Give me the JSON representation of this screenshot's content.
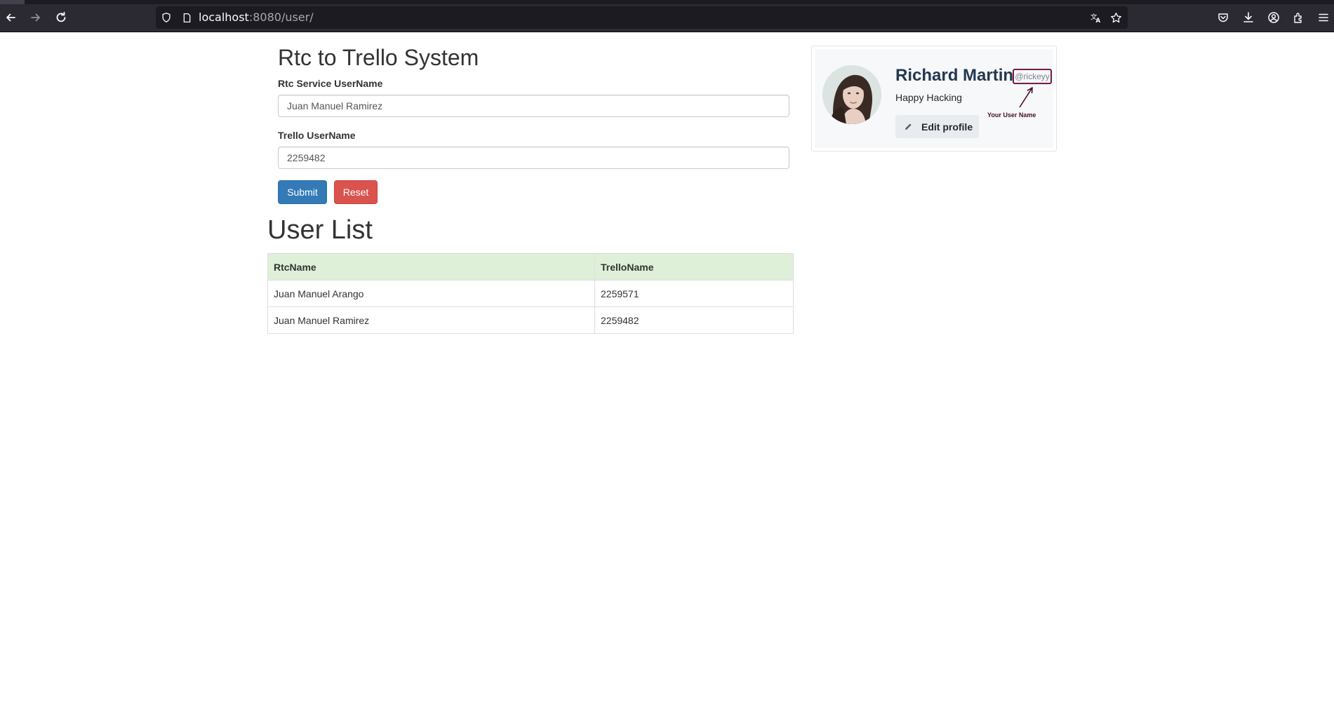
{
  "browser": {
    "url_host": "localhost",
    "url_rest": ":8080/user/",
    "icons": {
      "back": "back-arrow-icon",
      "forward": "forward-arrow-icon",
      "reload": "reload-icon",
      "shield": "tracking-protection-icon",
      "page": "page-info-icon",
      "translate": "translate-icon",
      "bookmark": "bookmark-star-icon",
      "pocket": "pocket-icon",
      "downloads": "download-icon",
      "account": "account-icon",
      "extensions": "extensions-icon",
      "menu": "hamburger-menu-icon"
    }
  },
  "form": {
    "title": "Rtc to Trello System",
    "rtc_label": "Rtc Service UserName",
    "rtc_value": "Juan Manuel Ramirez",
    "trello_label": "Trello UserName",
    "trello_value": "2259482",
    "submit_label": "Submit",
    "reset_label": "Reset"
  },
  "user_list": {
    "title": "User List",
    "columns": [
      "RtcName",
      "TrelloName"
    ],
    "rows": [
      [
        "Juan Manuel Arango",
        "2259571"
      ],
      [
        "Juan Manuel Ramirez",
        "2259482"
      ]
    ]
  },
  "profile": {
    "name": "Richard Martin",
    "handle": "@rickeyy",
    "bio": "Happy Hacking",
    "edit_label": "Edit profile",
    "annotation": "Your User Name",
    "colors": {
      "name": "#24384e",
      "annotation": "#7a1a45"
    }
  },
  "colors": {
    "submit": "#337ab7",
    "reset": "#d9534f",
    "table_header": "#dff0d8",
    "toolbar": "#2b2a33"
  }
}
